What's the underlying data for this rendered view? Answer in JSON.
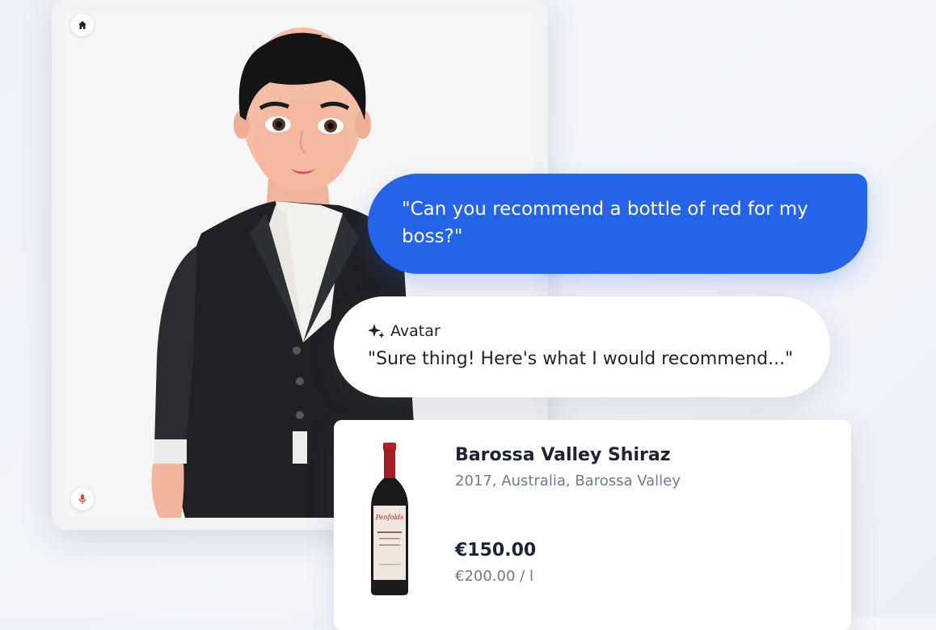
{
  "avatar_panel": {
    "home_button_icon": "home-icon",
    "mic_button_icon": "microphone-icon",
    "mic_color": "#e5483f"
  },
  "chat": {
    "user_message": "\"Can you recommend a bottle of red for my boss?\"",
    "user_bubble_color": "#2563e9",
    "assistant_icon": "sparkle-icon",
    "assistant_name": "Avatar",
    "assistant_message": "\"Sure thing! Here's what I would recommend...\""
  },
  "product": {
    "name": "Barossa Valley Shiraz",
    "details": "2017, Australia, Barossa Valley",
    "price": "€150.00",
    "unit_price": "€200.00 / l",
    "image": "wine-bottle-image"
  }
}
